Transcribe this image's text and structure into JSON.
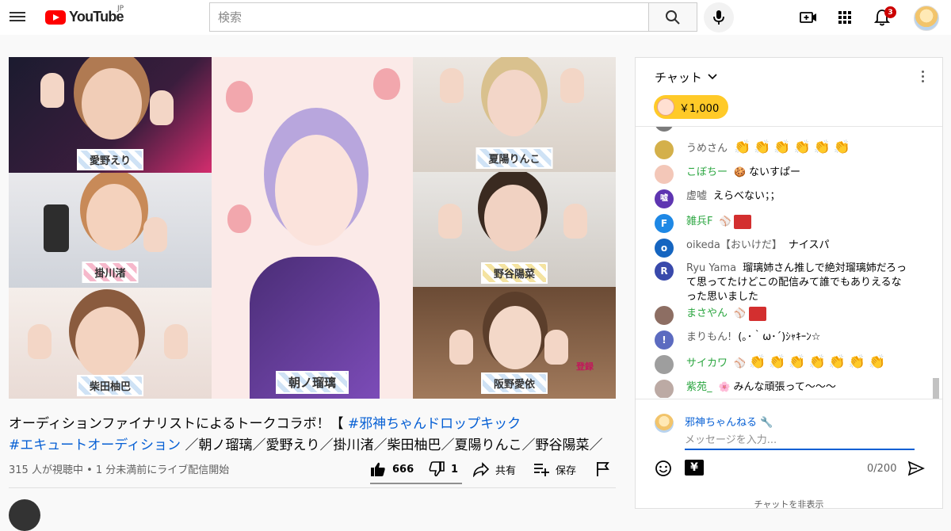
{
  "header": {
    "logo_text": "YouTube",
    "logo_region": "JP",
    "search_placeholder": "検索",
    "notification_count": "3"
  },
  "video": {
    "participants": [
      "愛野えり",
      "掛川渚",
      "柴田柚巴",
      "朝ノ瑠璃",
      "夏陽りんこ",
      "野谷陽菜",
      "阪野愛依"
    ],
    "watermark": "登録"
  },
  "title": {
    "line1_text": "オーディションファイナリストによるトークコラボ！【 ",
    "line1_tag": "#邪神ちゃんドロップキック",
    "line2_tag": "#エキュートオーディション",
    "line2_text": " ／朝ノ瑠璃／愛野えり／掛川渚／柴田柚巴／夏陽りんこ／野谷陽菜／"
  },
  "stats": {
    "views": "315 人が視聴中",
    "separator": " • ",
    "started": "1 分未満前にライブ配信開始"
  },
  "actions": {
    "like_count": "666",
    "dislike_count": "1",
    "share_label": "共有",
    "save_label": "保存"
  },
  "chat": {
    "header_label": "チャット",
    "superchat_amount": "￥1,000",
    "messages": [
      {
        "author": "うめさん",
        "text": "",
        "emoji_count": 6,
        "member": false,
        "avatar_color": "#d4b04a",
        "avatar_letter": ""
      },
      {
        "author": "こぼちー",
        "text": "ないすぱー",
        "emoji_count": 0,
        "member": true,
        "avatar_color": "#f3c7b8",
        "avatar_letter": ""
      },
      {
        "author": "虚嘘",
        "text": "えらべない；；",
        "emoji_count": 0,
        "member": false,
        "avatar_color": "#5e35b1",
        "avatar_letter": "嘘"
      },
      {
        "author": "雑兵F",
        "text": "",
        "emoji_count": 0,
        "member": true,
        "avatar_color": "#1e88e5",
        "avatar_letter": "F"
      },
      {
        "author": "oikeda【おいけだ】",
        "text": "ナイスパ",
        "emoji_count": 0,
        "member": false,
        "avatar_color": "#1565c0",
        "avatar_letter": "o"
      },
      {
        "author": "Ryu Yama",
        "text": "瑠璃姉さん推しで絶対瑠璃姉だろって思ってたけどこの配信みて誰でもありえるなった思いました",
        "emoji_count": 0,
        "member": false,
        "avatar_color": "#3949ab",
        "avatar_letter": "R"
      },
      {
        "author": "まさやん",
        "text": "",
        "emoji_count": 0,
        "member": true,
        "avatar_color": "#8d6e63",
        "avatar_letter": ""
      },
      {
        "author": "まりもん!",
        "text": "(｡･｀ω･´)ｼｬｷｰﾝ☆",
        "emoji_count": 0,
        "member": false,
        "avatar_color": "#5c6bc0",
        "avatar_letter": "!"
      },
      {
        "author": "サイカワ",
        "text": "",
        "emoji_count": 7,
        "member": true,
        "avatar_color": "#9e9e9e",
        "avatar_letter": ""
      },
      {
        "author": "紫苑_",
        "text": "みんな頑張って〜〜〜",
        "emoji_count": 0,
        "member": true,
        "avatar_color": "#bcaaa4",
        "avatar_letter": ""
      }
    ],
    "my_name": "邪神ちゃんねる",
    "input_placeholder": "メッセージを入力...",
    "char_counter": "0/200",
    "yen_label": "¥",
    "hide_label": "チャットを非表示"
  },
  "colors": {
    "brand_red": "#ff0000",
    "link_blue": "#065fd4",
    "member_green": "#2ba640",
    "superchat_yellow": "#ffca28"
  }
}
